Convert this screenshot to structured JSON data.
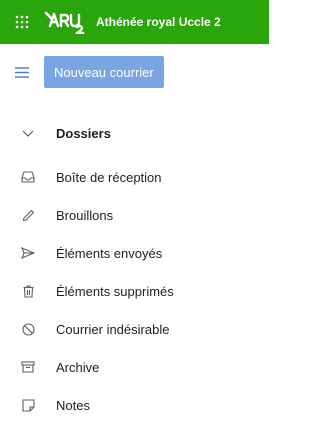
{
  "header": {
    "logo_text": "ARU2",
    "org_name": "Athénée royal Uccle 2",
    "brand_color": "#2aa50c"
  },
  "toolbar": {
    "new_mail_label": "Nouveau courrier",
    "button_color": "#7aa5e3"
  },
  "folders": {
    "section_label": "Dossiers",
    "items": [
      {
        "label": "Boîte de réception",
        "icon": "inbox-icon"
      },
      {
        "label": "Brouillons",
        "icon": "pencil-icon"
      },
      {
        "label": "Éléments envoyés",
        "icon": "send-icon"
      },
      {
        "label": "Éléments supprimés",
        "icon": "trash-icon"
      },
      {
        "label": "Courrier indésirable",
        "icon": "block-icon"
      },
      {
        "label": "Archive",
        "icon": "archive-icon"
      },
      {
        "label": "Notes",
        "icon": "note-icon"
      }
    ]
  }
}
